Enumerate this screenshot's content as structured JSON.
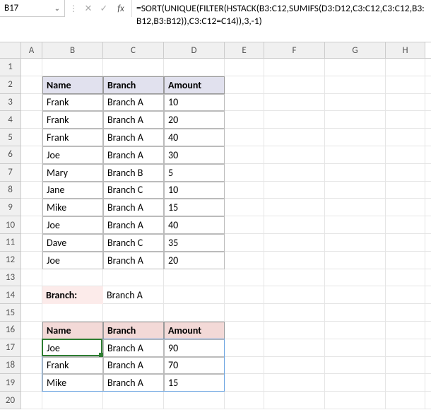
{
  "nameBox": "B17",
  "formula": "=SORT(UNIQUE(FILTER(HSTACK(B3:C12,SUMIFS(D3:D12,C3:C12,C3:C12,B3:B12,B3:B12)),C3:C12=C14)),3,-1)",
  "columns": [
    "A",
    "B",
    "C",
    "D",
    "E",
    "F",
    "G",
    "H"
  ],
  "rowCount": 20,
  "table1": {
    "headers": {
      "name": "Name",
      "branch": "Branch",
      "amount": "Amount"
    },
    "rows": [
      {
        "name": "Frank",
        "branch": "Branch A",
        "amount": "10"
      },
      {
        "name": "Frank",
        "branch": "Branch A",
        "amount": "20"
      },
      {
        "name": "Frank",
        "branch": "Branch A",
        "amount": "40"
      },
      {
        "name": "Joe",
        "branch": "Branch A",
        "amount": "30"
      },
      {
        "name": "Mary",
        "branch": "Branch B",
        "amount": "5"
      },
      {
        "name": "Jane",
        "branch": "Branch C",
        "amount": "10"
      },
      {
        "name": "Mike",
        "branch": "Branch A",
        "amount": "15"
      },
      {
        "name": "Joe",
        "branch": "Branch A",
        "amount": "40"
      },
      {
        "name": "Dave",
        "branch": "Branch C",
        "amount": "35"
      },
      {
        "name": "Joe",
        "branch": "Branch A",
        "amount": "20"
      }
    ]
  },
  "filter": {
    "label": "Branch:",
    "value": "Branch A"
  },
  "table2": {
    "headers": {
      "name": "Name",
      "branch": "Branch",
      "amount": "Amount"
    },
    "rows": [
      {
        "name": "Joe",
        "branch": "Branch A",
        "amount": "90"
      },
      {
        "name": "Frank",
        "branch": "Branch A",
        "amount": "70"
      },
      {
        "name": "Mike",
        "branch": "Branch A",
        "amount": "15"
      }
    ]
  },
  "icons": {
    "dropdown": "⌄",
    "cancel": "✕",
    "confirm": "✓"
  },
  "chart_data": null
}
